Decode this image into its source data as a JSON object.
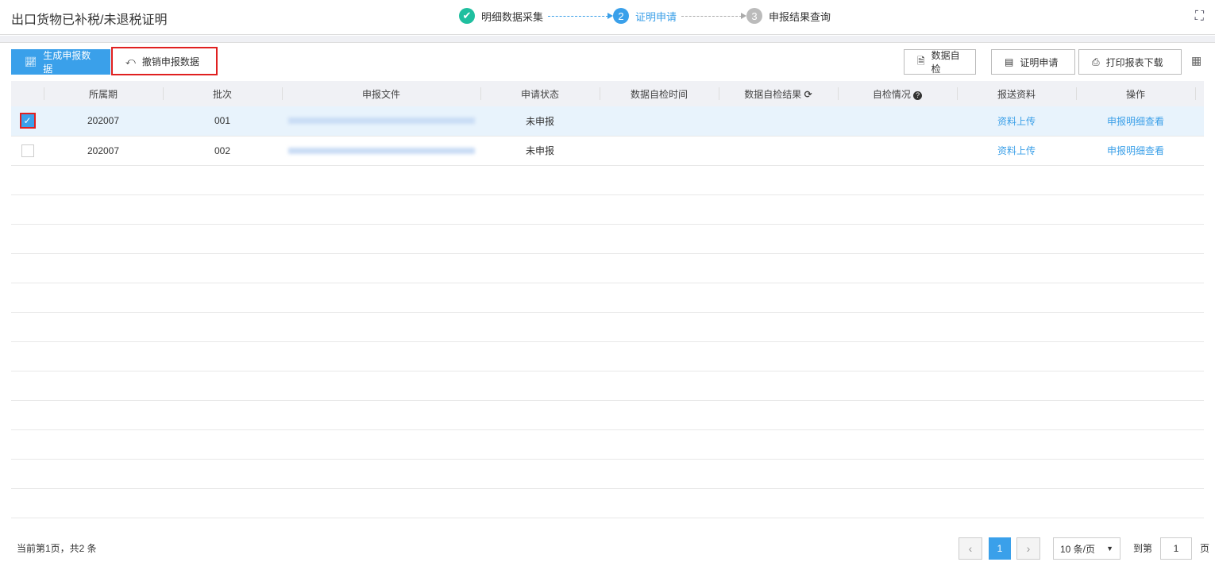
{
  "header": {
    "title": "出口货物已补税/未退税证明",
    "steps": [
      {
        "num": "✔",
        "label": "明细数据采集",
        "state": "done"
      },
      {
        "num": "2",
        "label": "证明申请",
        "state": "active"
      },
      {
        "num": "3",
        "label": "申报结果查询",
        "state": "pending"
      }
    ]
  },
  "toolbar": {
    "generate": "生成申报数据",
    "revoke": "撤销申报数据",
    "self_check": "数据自检",
    "apply": "证明申请",
    "print": "打印报表下载"
  },
  "table": {
    "columns": [
      "所属期",
      "批次",
      "申报文件",
      "申请状态",
      "数据自检时间",
      "数据自检结果",
      "自检情况",
      "报送资料",
      "操作"
    ],
    "rows": [
      {
        "checked": true,
        "period": "202007",
        "batch": "001",
        "status": "未申报",
        "check_time": "",
        "check_result": "",
        "check_info": "",
        "upload": "资料上传",
        "action": "申报明细查看"
      },
      {
        "checked": false,
        "period": "202007",
        "batch": "002",
        "status": "未申报",
        "check_time": "",
        "check_result": "",
        "check_info": "",
        "upload": "资料上传",
        "action": "申报明细查看"
      }
    ]
  },
  "footer": {
    "summary": "当前第1页，共2 条",
    "current_page": "1",
    "page_size": "10 条/页",
    "goto_label": "到第",
    "goto_value": "1",
    "page_unit": "页"
  },
  "colors": {
    "accent": "#3aa0ea",
    "done": "#1fbf9f",
    "highlight": "#e02020"
  }
}
